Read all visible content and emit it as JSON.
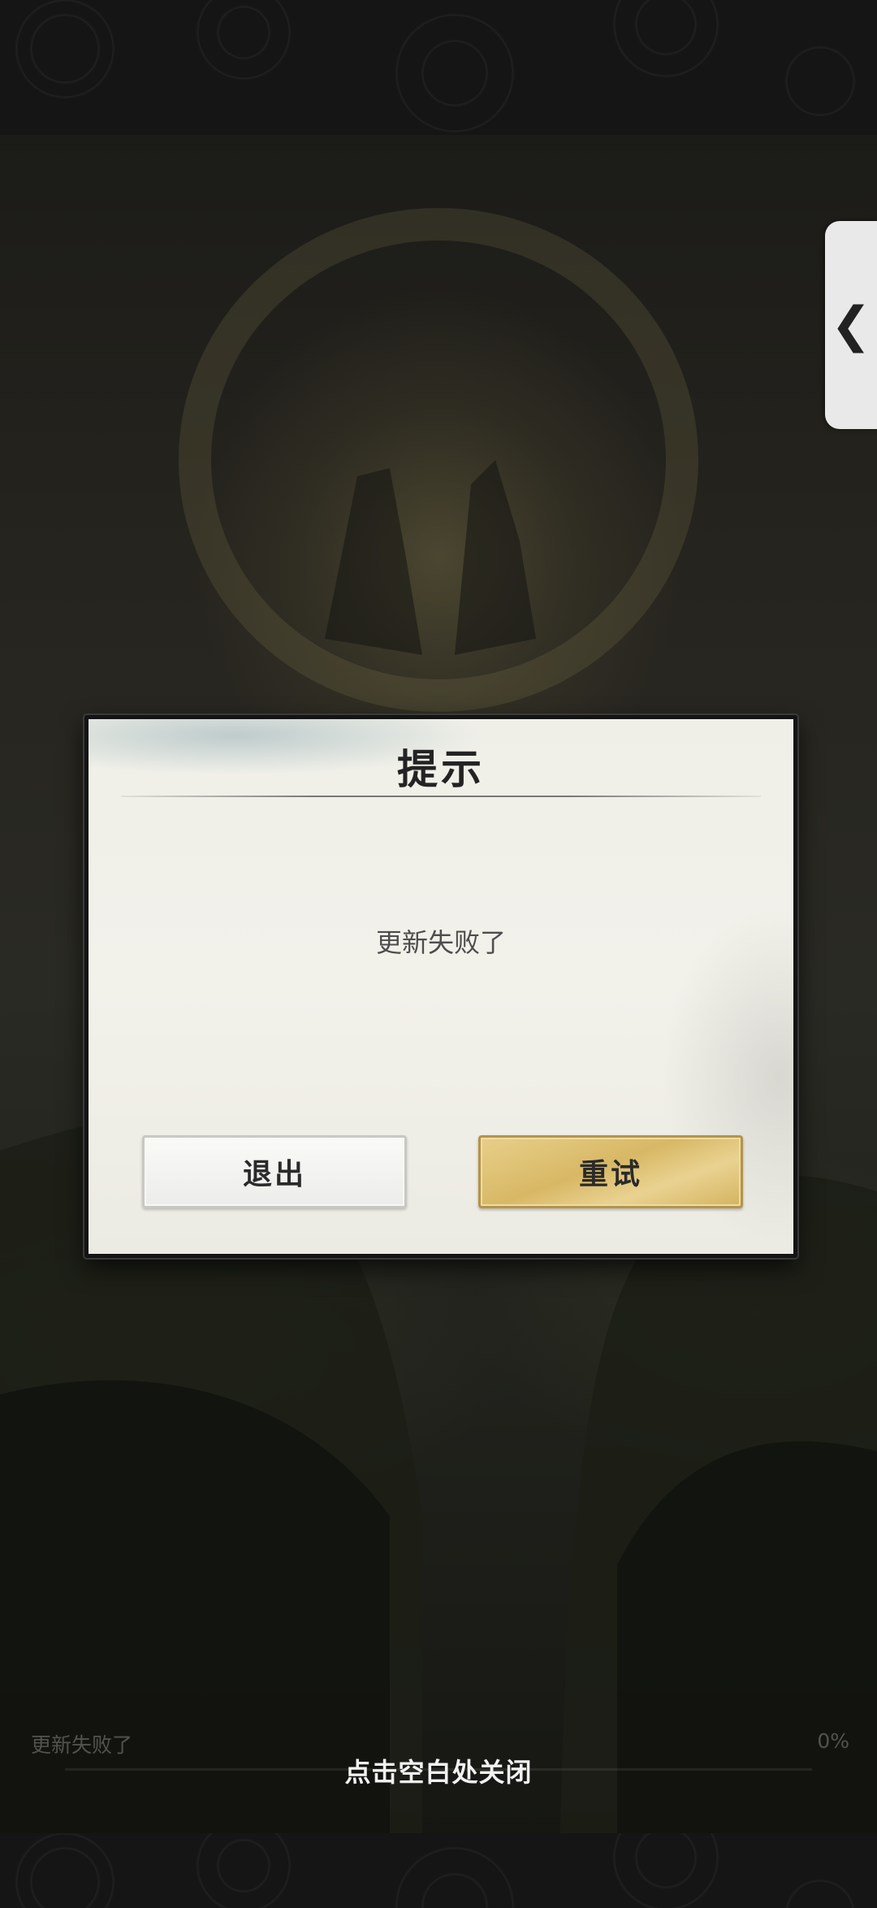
{
  "dialog": {
    "title": "提示",
    "message": "更新失败了",
    "exit_label": "退出",
    "retry_label": "重试"
  },
  "loading": {
    "status": "更新失败了",
    "percent_label": "0%",
    "progress": 0
  },
  "overlay": {
    "close_hint": "点击空白处关闭"
  },
  "side_tab": {
    "icon": "chevron-left-icon",
    "glyph": "❮"
  },
  "colors": {
    "retry_button": "#d8b865",
    "dialog_background": "#f2f1ea"
  }
}
